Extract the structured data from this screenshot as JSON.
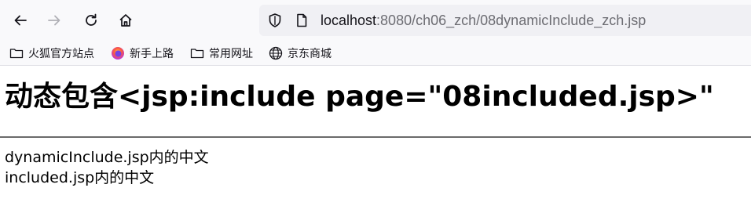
{
  "browser": {
    "url_host": "localhost",
    "url_rest": ":8080/ch06_zch/08dynamicInclude_zch.jsp"
  },
  "bookmarks": [
    {
      "label": "火狐官方站点",
      "icon": "folder-icon"
    },
    {
      "label": "新手上路",
      "icon": "firefox-icon"
    },
    {
      "label": "常用网址",
      "icon": "folder-icon"
    },
    {
      "label": "京东商城",
      "icon": "globe-icon"
    }
  ],
  "page": {
    "heading": "动态包含<jsp:include page=\"08included.jsp>\"",
    "line1": "dynamicInclude.jsp内的中文",
    "line2": "included.jsp内的中文"
  },
  "colors": {
    "toolbar_bg": "#f9f9fb",
    "urlbar_bg": "#f0f0f4",
    "rule": "#6a6a6a"
  }
}
